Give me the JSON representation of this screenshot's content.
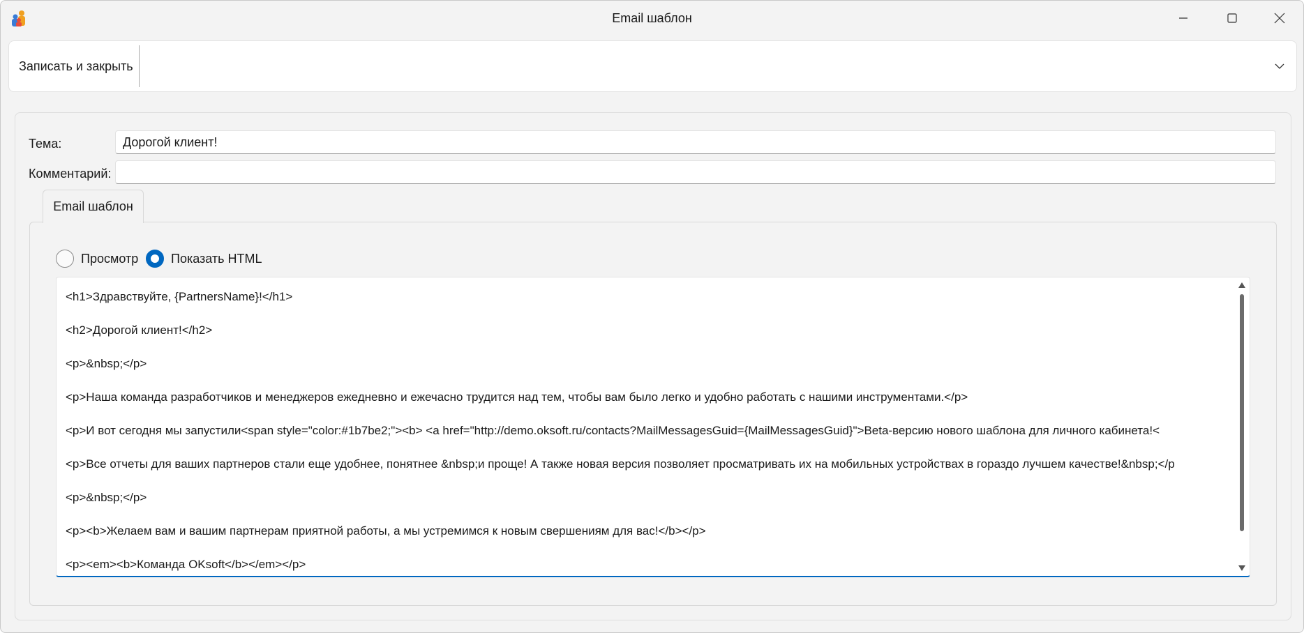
{
  "window": {
    "title": "Email шаблон"
  },
  "toolbar": {
    "save_close_label": "Записать и закрыть"
  },
  "form": {
    "subject_label": "Тема:",
    "subject_value": "Дорогой клиент!",
    "comment_label": "Комментарий:",
    "comment_value": ""
  },
  "tabs": [
    {
      "label": "Email шаблон",
      "active": true
    }
  ],
  "view_mode": {
    "preview_label": "Просмотр",
    "html_label": "Показать HTML",
    "selected": "html"
  },
  "editor": {
    "lines": [
      "<h1>Здравствуйте, {PartnersName}!</h1>",
      "<h2>Дорогой клиент!</h2>",
      "<p>&nbsp;</p>",
      "<p>Наша команда разработчиков и менеджеров ежедневно и ежечасно трудится над тем, чтобы вам было легко и удобно работать с нашими инструментами.</p>",
      "<p>И вот сегодня мы запустили<span style=\"color:#1b7be2;\"><b> <a href=\"http://demo.oksoft.ru/contacts?MailMessagesGuid={MailMessagesGuid}\">Beta-версию нового шаблона для личного кабинета!<",
      "<p>Все отчеты для ваших партнеров стали еще удобнее, понятнее &nbsp;и проще! А также новая версия позволяет просматривать их на мобильных устройствах в гораздо лучшем качестве!&nbsp;</p",
      "<p>&nbsp;</p>",
      "<p><b>Желаем вам и вашим партнерам приятной работы, а мы устремимся к новым свершениям для вас!</b></p>",
      "<p><em><b>Команда OKsoft</b></em></p>"
    ]
  },
  "colors": {
    "accent": "#0067c0",
    "window_bg": "#f3f3f3",
    "surface": "#ffffff"
  },
  "icons": [
    "app-icon",
    "minimize-icon",
    "maximize-icon",
    "close-icon",
    "chevron-down-icon",
    "scroll-up-arrow-icon",
    "scroll-down-arrow-icon"
  ]
}
